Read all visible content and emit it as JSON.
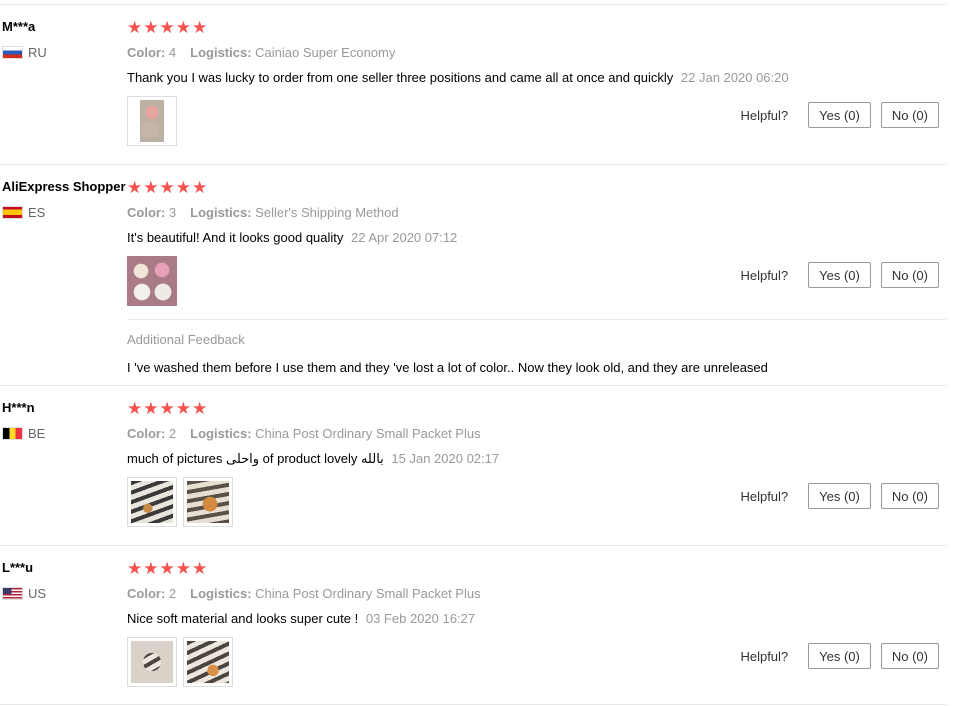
{
  "helpful_label": "Helpful?",
  "color_label": "Color:",
  "logistics_label": "Logistics:",
  "reviews": [
    {
      "user": "M***a",
      "country": "RU",
      "flag": "ru",
      "stars": "★★★★★",
      "color": "4",
      "logistics": "Cainiao Super Economy",
      "text": "Thank you I was lucky to order from one seller three positions and came all at once and quickly",
      "date": "22 Jan 2020 06:20",
      "yes": "Yes (0)",
      "no": "No (0)"
    },
    {
      "user": "AliExpress Shopper",
      "country": "ES",
      "flag": "es",
      "stars": "★★★★★",
      "color": "3",
      "logistics": "Seller's Shipping Method",
      "text": "It's beautiful! And it looks good quality",
      "date": "22 Apr 2020 07:12",
      "yes": "Yes (0)",
      "no": "No (0)",
      "additional_title": "Additional Feedback",
      "additional_text": "I 've washed them before I use them and they 've lost a lot of color.. Now they look old, and they are unreleased"
    },
    {
      "user": "H***n",
      "country": "BE",
      "flag": "be",
      "stars": "★★★★★",
      "color": "2",
      "logistics": "China Post Ordinary Small Packet Plus",
      "text": "بالله of product lovely واحلى much of pictures",
      "date": "15 Jan 2020 02:17",
      "yes": "Yes (0)",
      "no": "No (0)"
    },
    {
      "user": "L***u",
      "country": "US",
      "flag": "us",
      "stars": "★★★★★",
      "color": "2",
      "logistics": "China Post Ordinary Small Packet Plus",
      "text": "Nice soft material and looks super cute !",
      "date": "03 Feb 2020 16:27",
      "yes": "Yes (0)",
      "no": "No (0)"
    }
  ]
}
